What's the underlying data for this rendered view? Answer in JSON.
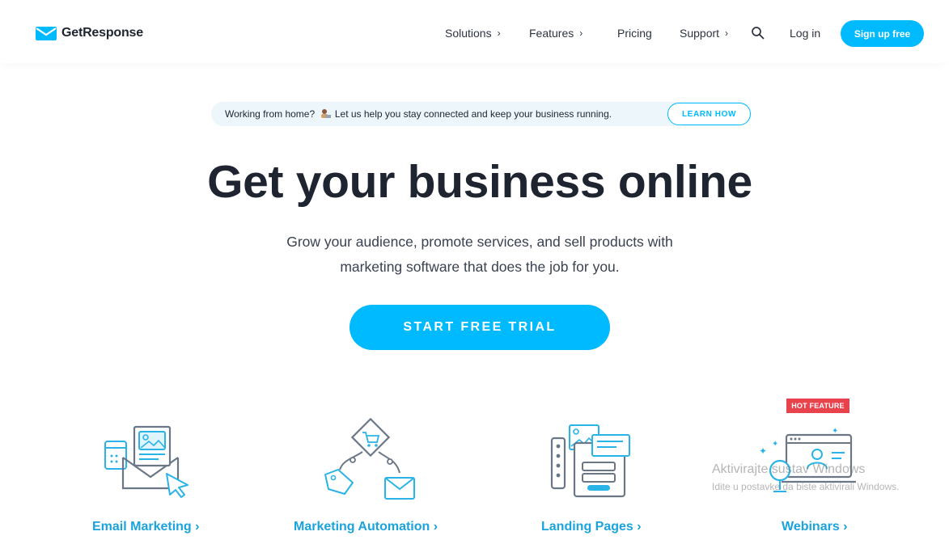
{
  "header": {
    "brand": "GetResponse",
    "nav": [
      {
        "label": "Solutions",
        "chevron": "›"
      },
      {
        "label": "Features",
        "chevron": "›"
      },
      {
        "label": "Pricing",
        "chevron": ""
      },
      {
        "label": "Support",
        "chevron": "›"
      }
    ],
    "search_icon": "search-icon",
    "login": "Log in",
    "signup": "Sign up free"
  },
  "banner": {
    "text_before": "Working from home?",
    "text_after": "Let us help you stay connected and keep your business running.",
    "button": "LEARN HOW"
  },
  "hero": {
    "title": "Get your business online",
    "subtitle_line1": "Grow your audience, promote services, and sell products with",
    "subtitle_line2": "marketing software that does the job for you.",
    "cta": "START FREE TRIAL"
  },
  "features": [
    {
      "label": "Email Marketing ›",
      "icon": "email-marketing-icon"
    },
    {
      "label": "Marketing Automation ›",
      "icon": "marketing-automation-icon"
    },
    {
      "label": "Landing Pages ›",
      "icon": "landing-pages-icon"
    },
    {
      "label": "Webinars ›",
      "icon": "webinars-icon",
      "badge": "HOT FEATURE"
    }
  ],
  "watermark": {
    "line1": "Aktivirajte sustav Windows",
    "line2": "Idite u postavke da biste aktivirali Windows."
  },
  "colors": {
    "accent": "#00baff",
    "link": "#1aa3dc",
    "hot": "#e8424c",
    "text": "#1e2430"
  }
}
